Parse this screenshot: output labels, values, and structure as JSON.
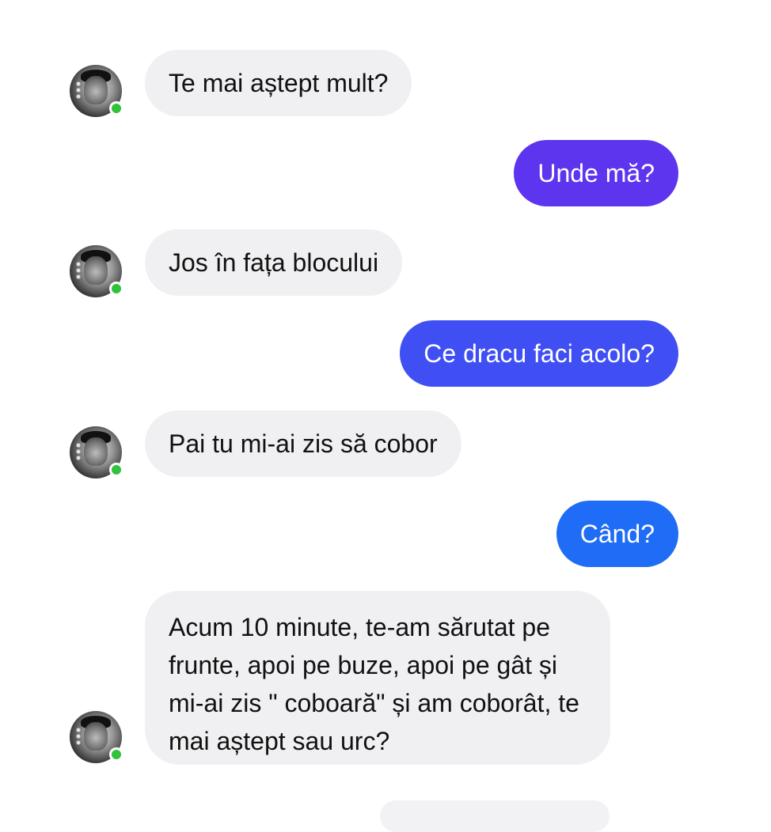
{
  "colors": {
    "incoming_bubble": "#f0f0f2",
    "outgoing_gradient": [
      "#6a2ef0",
      "#5a34f2",
      "#4a49f4",
      "#2f63f5",
      "#1a73f6"
    ],
    "online": "#31c23b"
  },
  "messages": [
    {
      "from": "contact",
      "text": "Te mai aștept mult?"
    },
    {
      "from": "me",
      "text": "Unde mă?"
    },
    {
      "from": "contact",
      "text": "Jos în fața blocului"
    },
    {
      "from": "me",
      "text": "Ce dracu faci acolo?"
    },
    {
      "from": "contact",
      "text": "Pai tu mi-ai zis să cobor"
    },
    {
      "from": "me",
      "text": "Când?"
    },
    {
      "from": "contact",
      "text": "Acum 10 minute, te-am sărutat pe frunte, apoi pe buze, apoi pe gât și mi-ai zis \" coboară\" și am coborât, te mai aștept sau urc?"
    }
  ],
  "avatar": {
    "icon": "contact-avatar-icon",
    "status": "online"
  }
}
